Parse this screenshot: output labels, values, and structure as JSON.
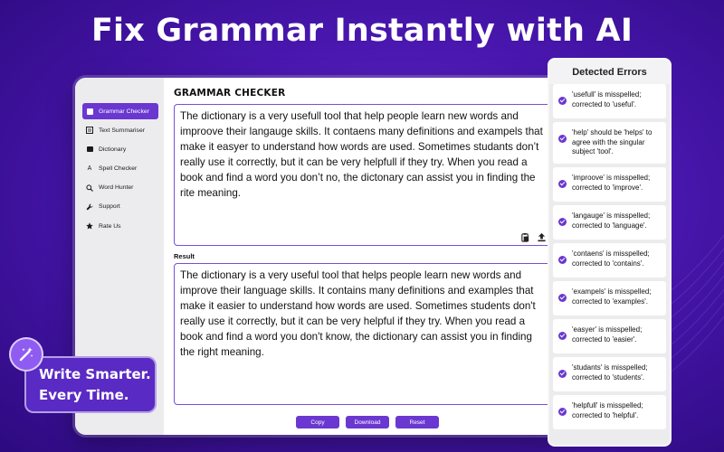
{
  "headline": "Fix Grammar Instantly with AI",
  "sidebar": {
    "items": [
      {
        "label": "Grammar Checker",
        "icon": "grammar-icon",
        "active": true
      },
      {
        "label": "Text Summariser",
        "icon": "summary-icon"
      },
      {
        "label": "Dictionary",
        "icon": "book-icon"
      },
      {
        "label": "Spell Checker",
        "icon": "spell-icon"
      },
      {
        "label": "Word Hunter",
        "icon": "search-icon"
      },
      {
        "label": "Support",
        "icon": "wrench-icon"
      },
      {
        "label": "Rate Us",
        "icon": "star-icon"
      }
    ]
  },
  "main": {
    "title": "GRAMMAR CHECKER",
    "input_text": "The dictionary is a very usefull tool that help people learn new words and improove their langauge skills. It contaens many definitions and exampels that make it easyer to understand how words are used. Sometimes studants don’t really use it correctly, but it can be very helpfull if they try. When you read a book and find a word you don’t no, the dictonary can assist you in finding the rite meaning.",
    "result_label": "Result",
    "result_text": "The dictionary is a very useful tool that helps people learn new words and improve their language skills. It contains many definitions and examples that make it easier to understand how words are used. Sometimes students don't really use it correctly, but it can be very helpful if they try. When you read a book and find a word you don't know, the dictionary can assist you in finding the right meaning.",
    "buttons": {
      "copy": "Copy",
      "download": "Download",
      "reset": "Reset"
    }
  },
  "errors": {
    "title": "Detected Errors",
    "items": [
      "'usefull' is misspelled; corrected to 'useful'.",
      "'help' should be 'helps' to agree with the singular subject 'tool'.",
      "'improove' is misspelled; corrected to 'improve'.",
      "'langauge' is misspelled; corrected to 'language'.",
      "'contaens' is misspelled; corrected to 'contains'.",
      "'exampels' is misspelled; corrected to 'examples'.",
      "'easyer' is misspelled; corrected to 'easier'.",
      "'studants' is misspelled; corrected to 'students'.",
      "'helpfull' is misspelled; corrected to 'helpful'."
    ]
  },
  "badge": {
    "line1": "Write Smarter.",
    "line2": "Every Time.",
    "icon": "magic-wand-icon"
  },
  "colors": {
    "accent": "#6a38d0",
    "background": "#4a17b0"
  }
}
